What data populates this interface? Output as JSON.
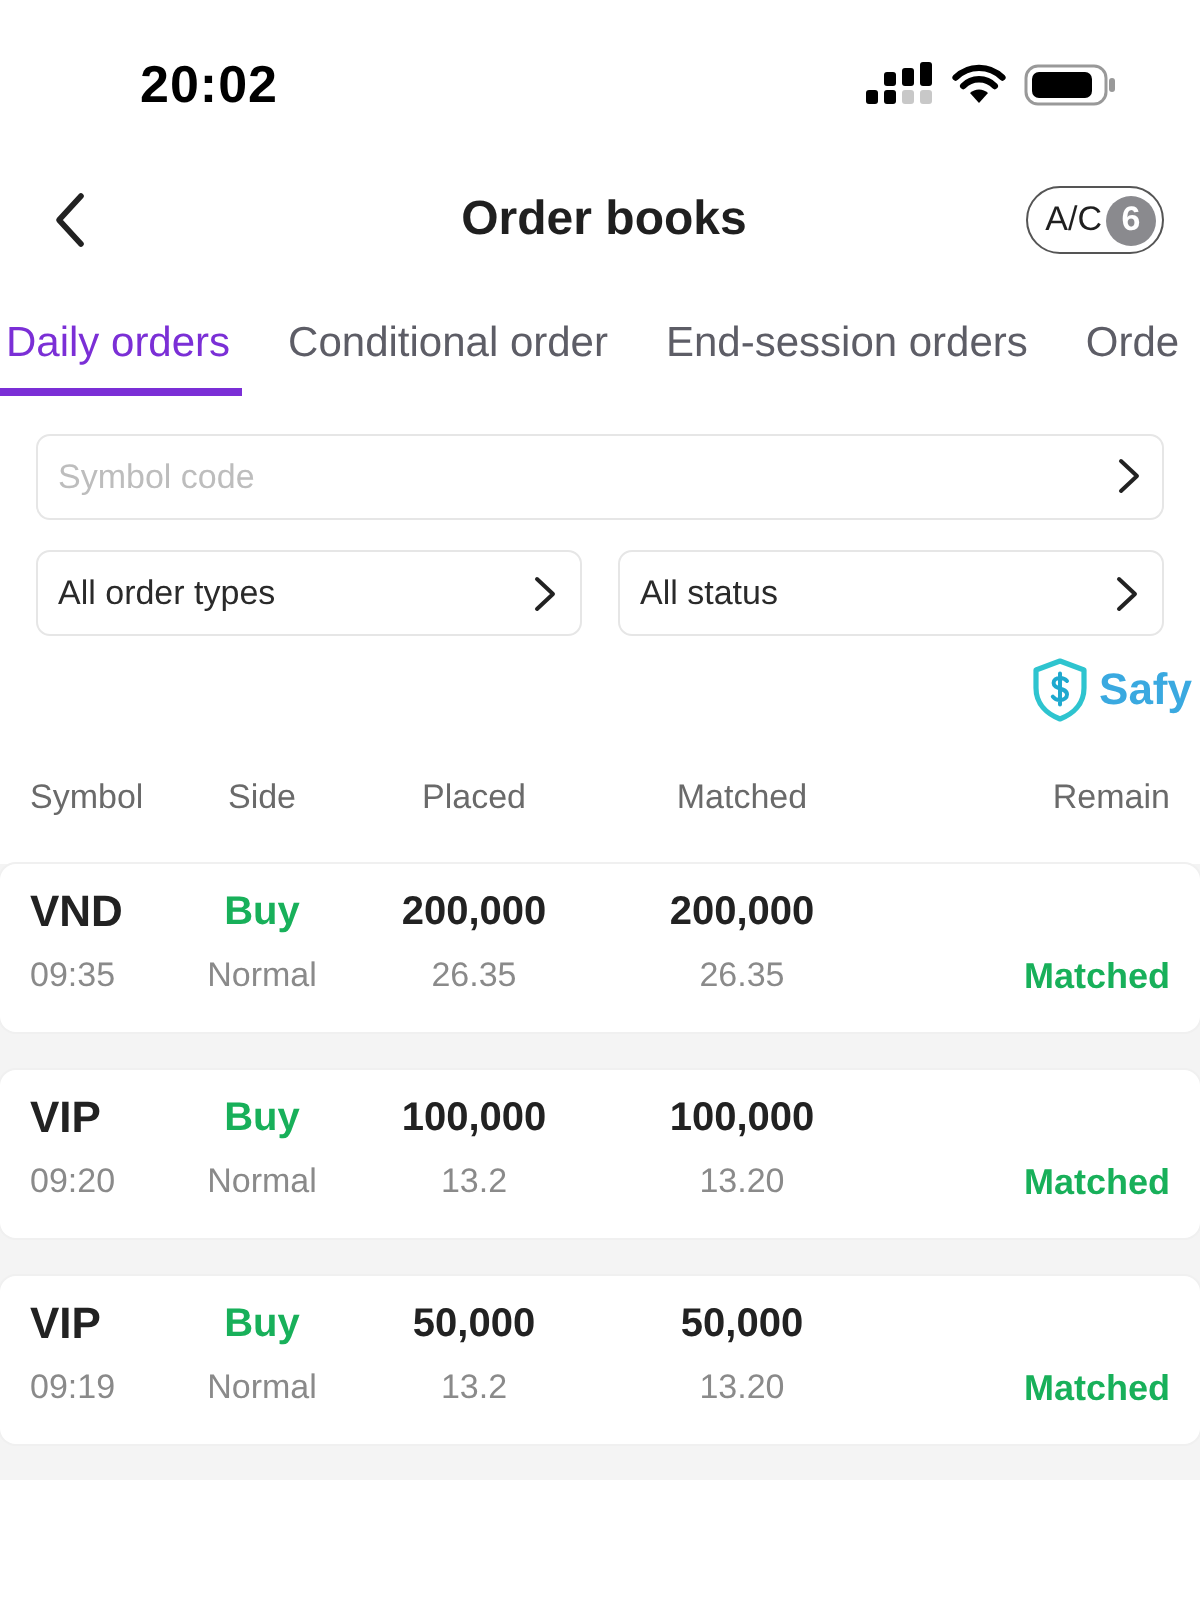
{
  "status_bar": {
    "time": "20:02"
  },
  "header": {
    "title": "Order books",
    "account_button": {
      "label": "A/C",
      "badge": "6"
    }
  },
  "tabs": [
    {
      "label": "Daily orders",
      "selected": true
    },
    {
      "label": "Conditional order",
      "selected": false
    },
    {
      "label": "End-session orders",
      "selected": false
    },
    {
      "label": "Orde",
      "selected": false
    }
  ],
  "filters": {
    "symbol_field": {
      "placeholder": "Symbol code"
    },
    "selects": [
      {
        "label": "All order types"
      },
      {
        "label": "All status"
      }
    ]
  },
  "brand": {
    "name": "Safy"
  },
  "table": {
    "columns": [
      "Symbol",
      "Side",
      "Placed",
      "Matched",
      "Remain"
    ],
    "rows": [
      {
        "symbol": "VND",
        "time": "09:35",
        "side": {
          "text": "Buy",
          "kind": "buy"
        },
        "order_type": "Normal",
        "placed_volume": "200,000",
        "placed_price": "26.35",
        "matched_volume": "200,000",
        "matched_price": "26.35",
        "status": {
          "text": "Matched",
          "kind": "matched"
        }
      },
      {
        "symbol": "VIP",
        "time": "09:20",
        "side": {
          "text": "Buy",
          "kind": "buy"
        },
        "order_type": "Normal",
        "placed_volume": "100,000",
        "placed_price": "13.2",
        "matched_volume": "100,000",
        "matched_price": "13.20",
        "status": {
          "text": "Matched",
          "kind": "matched"
        }
      },
      {
        "symbol": "VIP",
        "time": "09:19",
        "side": {
          "text": "Buy",
          "kind": "buy"
        },
        "order_type": "Normal",
        "placed_volume": "50,000",
        "placed_price": "13.2",
        "matched_volume": "50,000",
        "matched_price": "13.20",
        "status": {
          "text": "Matched",
          "kind": "matched"
        }
      }
    ]
  }
}
